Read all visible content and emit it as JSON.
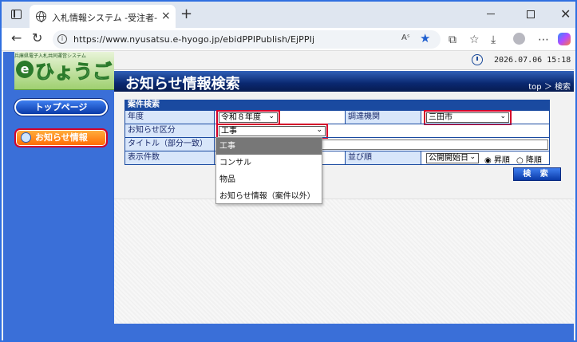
{
  "browser": {
    "tab_title": "入札情報システム -受注者-",
    "tab_close": "×",
    "new_tab": "+",
    "url": "https://www.nyusatsu.e-hyogo.jp/ebidPPIPublish/EjPPIj",
    "read_aloud": "Aˢ",
    "min_label": "",
    "close_label": "✕"
  },
  "site": {
    "logo_small": "兵庫県電子入札共同運営システム",
    "logo_e": "e",
    "logo_main": "ひょうご",
    "datetime": "2026.07.06 15:18"
  },
  "nav": {
    "top_button": "トップページ",
    "info_button": "お知らせ情報"
  },
  "page": {
    "title": "お知らせ情報検索",
    "breadcrumb": "top ＞ 検索"
  },
  "form": {
    "section_title": "案件検索",
    "year_label": "年度",
    "year_value": "令和８年度",
    "agency_label": "調達機関",
    "agency_value": "三田市",
    "category_label": "お知らせ区分",
    "category_value": "工事",
    "title_label": "タイトル（部分一致）",
    "title_value": "",
    "count_label": "表示件数",
    "order_label": "並び順",
    "order_value": "公開開始日",
    "asc_label": "昇順",
    "desc_label": "降順",
    "search_button": "検 索"
  },
  "dropdown": {
    "options": [
      "工事",
      "コンサル",
      "物品",
      "お知らせ情報（案件以外）"
    ],
    "selected_index": 0
  },
  "colors": {
    "accent": "#1a4aa0",
    "highlight": "#d4002a",
    "info_button": "#ff8a1a"
  }
}
